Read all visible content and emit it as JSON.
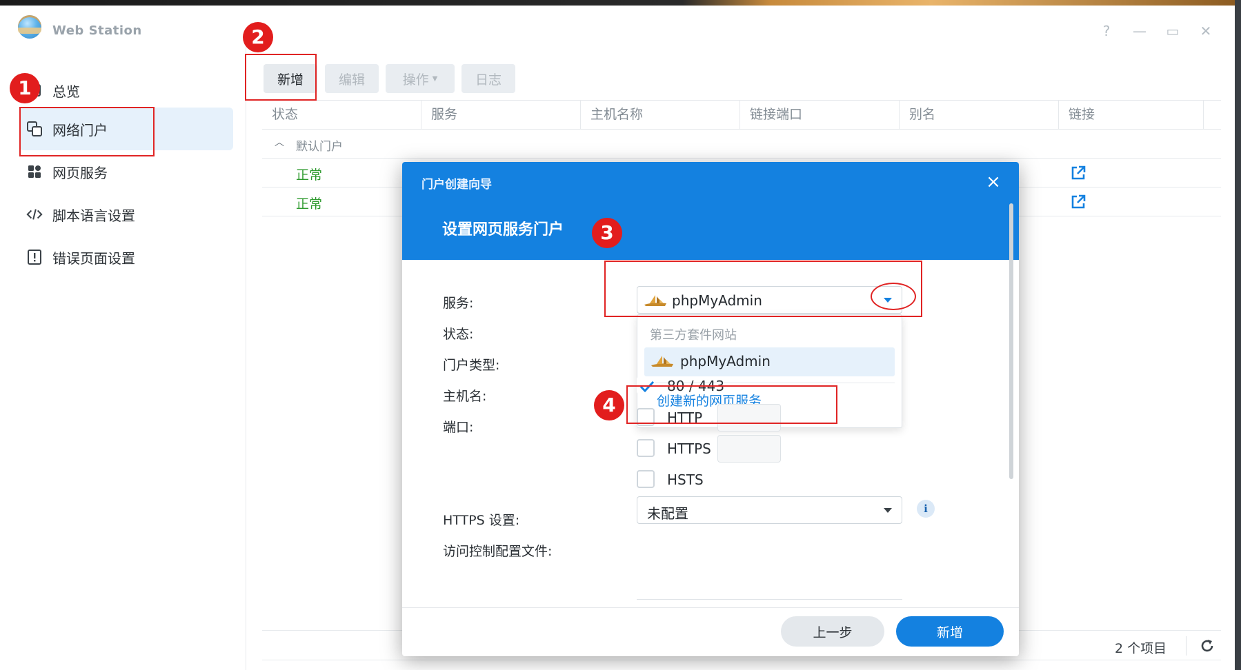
{
  "window": {
    "title": "Web Station"
  },
  "window_controls": {
    "help": "?",
    "minimize": "—",
    "maximize": "▭",
    "close": "✕"
  },
  "sidebar": {
    "items": [
      {
        "label": "总览",
        "icon": "overview-icon"
      },
      {
        "label": "网络门户",
        "icon": "portal-icon"
      },
      {
        "label": "网页服务",
        "icon": "grid-icon"
      },
      {
        "label": "脚本语言设置",
        "icon": "code-icon"
      },
      {
        "label": "错误页面设置",
        "icon": "alert-icon"
      }
    ],
    "active_index": 1
  },
  "toolbar": {
    "add": "新增",
    "edit": "编辑",
    "action": "操作",
    "log": "日志"
  },
  "grid": {
    "columns": [
      "状态",
      "服务",
      "主机名称",
      "链接端口",
      "别名",
      "链接"
    ],
    "group_label": "默认门户",
    "rows": [
      {
        "status": "正常"
      },
      {
        "status": "正常"
      }
    ],
    "footer_count": "2 个项目"
  },
  "dialog": {
    "caption": "门户创建向导",
    "heading": "设置网页服务门户",
    "fields": {
      "service": "服务:",
      "status": "状态:",
      "portal_type": "门户类型:",
      "hostname": "主机名:",
      "port": "端口:",
      "https_settings": "HTTPS 设置:",
      "access_profile": "访问控制配置文件:"
    },
    "service_value": "phpMyAdmin",
    "dropdown": {
      "group": "第三方套件网站",
      "option": "phpMyAdmin",
      "create": "创建新的网页服务"
    },
    "ports": {
      "default": "80 / 443",
      "http": "HTTP",
      "https": "HTTPS",
      "default_checked": true
    },
    "hsts": "HSTS",
    "access_profile_value": "未配置",
    "buttons": {
      "back": "上一步",
      "add": "新增"
    }
  },
  "annotations": [
    "1",
    "2",
    "3",
    "4"
  ],
  "colors": {
    "accent": "#1481e0",
    "status_ok": "#2e9a2e",
    "annotation": "#e02424"
  }
}
